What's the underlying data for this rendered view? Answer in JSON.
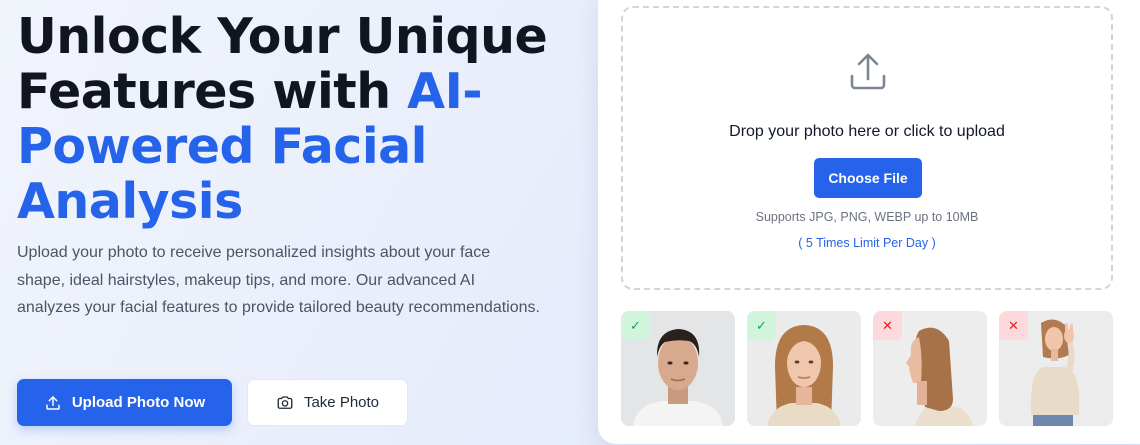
{
  "hero": {
    "headline_line1": "Unlock Your Unique",
    "headline_line2_plain": "Features with ",
    "headline_line2_accent": "AI-",
    "headline_line3_accent": "Powered Facial",
    "headline_line4_accent": "Analysis",
    "description": "Upload your photo to receive personalized insights about your face shape, ideal hairstyles, makeup tips, and more. Our advanced AI analyzes your facial features to provide tailored beauty recommendations.",
    "upload_button_label": "Upload Photo Now",
    "upload_button_icon": "upload-icon",
    "take_photo_label": "Take Photo",
    "take_photo_icon": "camera-icon"
  },
  "upload_panel": {
    "icon": "upload-icon",
    "drop_text": "Drop your photo here or click to upload",
    "choose_file_label": "Choose File",
    "supports_text": "Supports JPG, PNG, WEBP up to 10MB",
    "limit_text": "( 5 Times Limit Per Day )"
  },
  "samples": [
    {
      "status": "good",
      "badge": "✓",
      "description": "front-facing man"
    },
    {
      "status": "good",
      "badge": "✓",
      "description": "front-facing woman"
    },
    {
      "status": "bad",
      "badge": "✕",
      "description": "profile view"
    },
    {
      "status": "bad",
      "badge": "✕",
      "description": "full body with hand"
    }
  ],
  "colors": {
    "accent": "#2563eb",
    "good_badge": "#d1f5dc",
    "bad_badge": "#fcd9da"
  }
}
